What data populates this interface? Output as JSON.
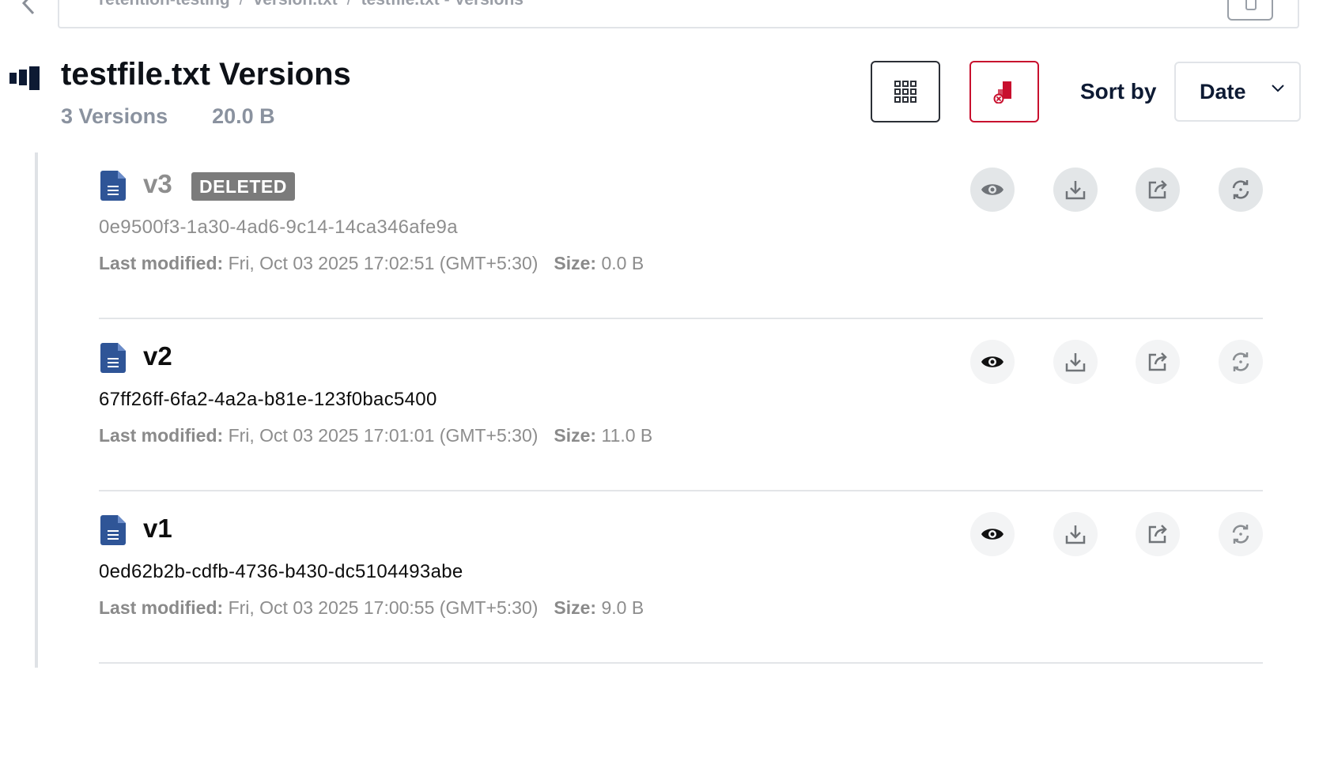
{
  "breadcrumb": {
    "items": [
      "retention-testing",
      "version.txt",
      "testfile.txt - Versions"
    ],
    "separator": "/"
  },
  "header": {
    "title": "testfile.txt Versions",
    "versions_count": "3 Versions",
    "total_size": "20.0 B",
    "sort_label": "Sort by",
    "sort_value": "Date"
  },
  "labels": {
    "last_modified": "Last modified:",
    "size": "Size:"
  },
  "versions": [
    {
      "name": "v3",
      "badge": "DELETED",
      "id": "0e9500f3-1a30-4ad6-9c14-14ca346afe9a",
      "last_modified": "Fri, Oct 03 2025 17:02:51 (GMT+5:30)",
      "size": "0.0 B"
    },
    {
      "name": "v2",
      "id": "67ff26ff-6fa2-4a2a-b81e-123f0bac5400",
      "last_modified": "Fri, Oct 03 2025 17:01:01 (GMT+5:30)",
      "size": "11.0 B"
    },
    {
      "name": "v1",
      "id": "0ed62b2b-cdfb-4736-b430-dc5104493abe",
      "last_modified": "Fri, Oct 03 2025 17:00:55 (GMT+5:30)",
      "size": "9.0 B"
    }
  ],
  "icons": {
    "back": "chevron-left-icon",
    "copy": "copy-icon",
    "object": "versions-stack-icon",
    "grid": "grid-icon",
    "deleted_toggle": "deleted-objects-icon",
    "sort_chevron": "chevron-down-icon",
    "file": "text-file-icon",
    "preview": "eye-icon",
    "download": "download-icon",
    "share": "share-icon",
    "restore": "restore-icon"
  },
  "colors": {
    "accent_red": "#c8102e",
    "file_icon_blue": "#2f5597",
    "muted_text": "#8a929f",
    "deleted_badge": "#7b7b7b"
  }
}
